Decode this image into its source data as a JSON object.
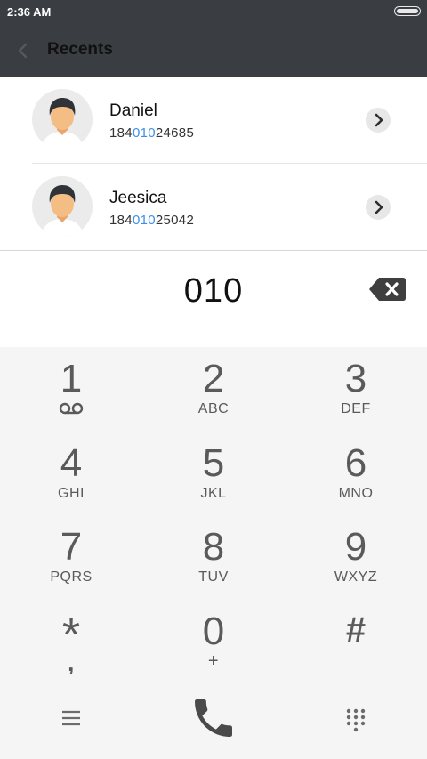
{
  "status_bar": {
    "time": "2:36 AM"
  },
  "header": {
    "title": "Recents"
  },
  "contacts": [
    {
      "name": "Daniel",
      "number_prefix": "184",
      "number_match": "010",
      "number_suffix": "24685"
    },
    {
      "name": "Jeesica",
      "number_prefix": "184",
      "number_match": "010",
      "number_suffix": "25042"
    }
  ],
  "dialer": {
    "entered": "010"
  },
  "keys": [
    {
      "digit": "1",
      "letters": ""
    },
    {
      "digit": "2",
      "letters": "ABC"
    },
    {
      "digit": "3",
      "letters": "DEF"
    },
    {
      "digit": "4",
      "letters": "GHI"
    },
    {
      "digit": "5",
      "letters": "JKL"
    },
    {
      "digit": "6",
      "letters": "MNO"
    },
    {
      "digit": "7",
      "letters": "PQRS"
    },
    {
      "digit": "8",
      "letters": "TUV"
    },
    {
      "digit": "9",
      "letters": "WXYZ"
    },
    {
      "digit": "*",
      "letters": ","
    },
    {
      "digit": "0",
      "letters": "+"
    },
    {
      "digit": "#",
      "letters": ""
    }
  ],
  "colors": {
    "header_bg": "#3a3d42",
    "match_highlight": "#3d8fe8",
    "call_button": "#4a4a4a"
  },
  "icons": {
    "back": "chevron-left-icon",
    "voicemail": "voicemail-icon",
    "menu": "menu-icon",
    "call": "phone-icon",
    "dialpad": "dialpad-icon",
    "backspace": "backspace-icon",
    "detail": "chevron-right-icon"
  }
}
